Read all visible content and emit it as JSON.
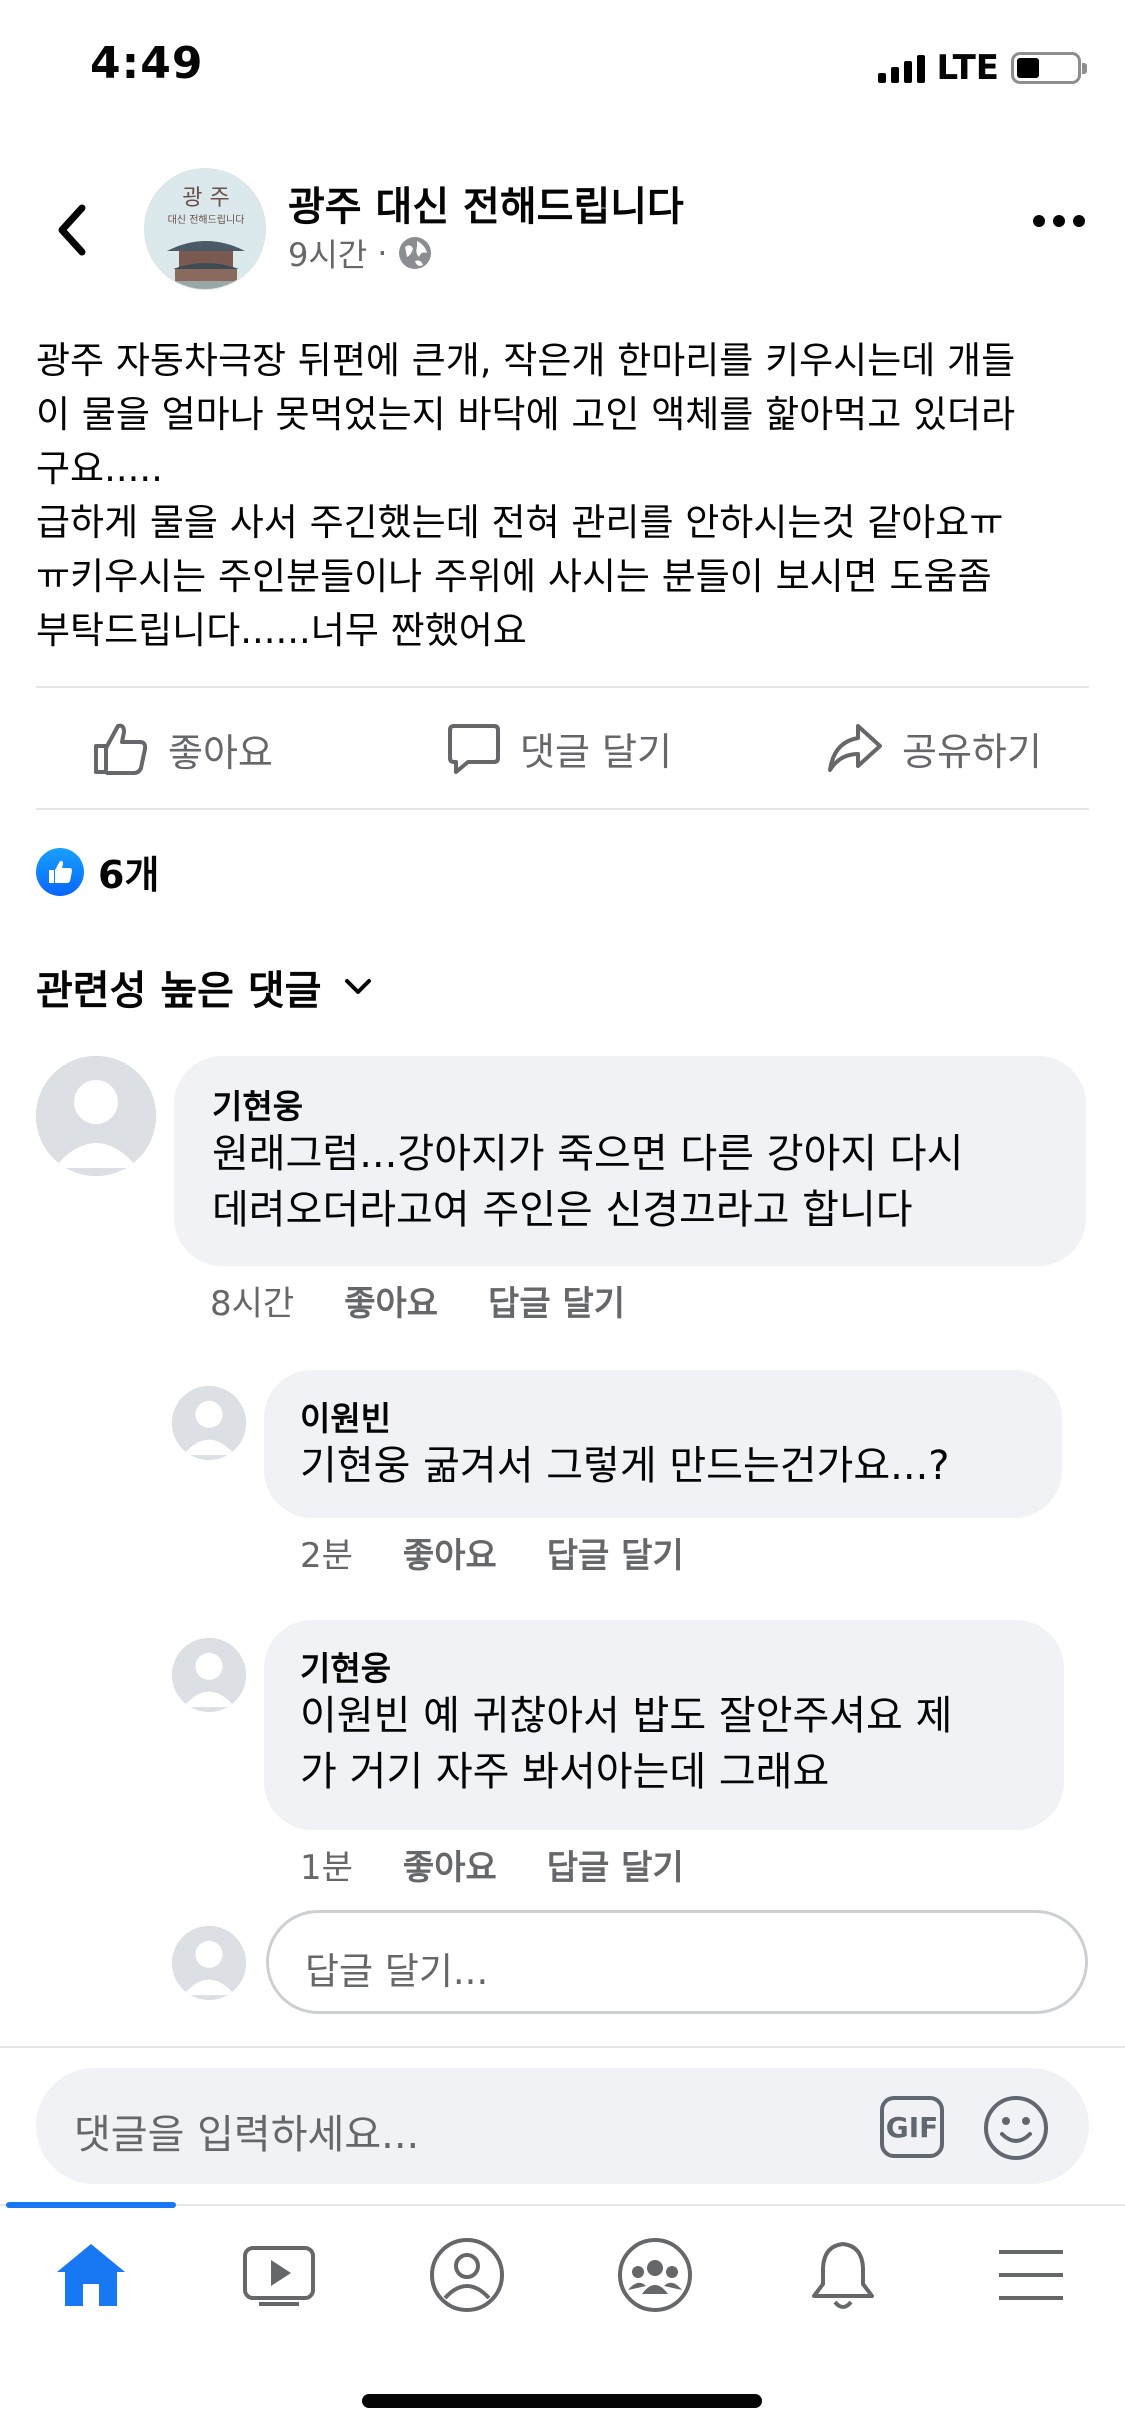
{
  "status_bar": {
    "time": "4:49",
    "network": "LTE"
  },
  "post": {
    "page_name": "광주 대신 전해드립니다",
    "avatar_text_line1": "광 주",
    "avatar_text_line2": "대신 전해드립니다",
    "time": "9시간",
    "separator": "·",
    "text": "광주 자동차극장 뒤편에 큰개, 작은개 한마리를 키우시는데 개들\n이 물을 얼마나 못먹었는지 바닥에 고인 액체를 핥아먹고 있더라\n구요.....\n급하게 물을 사서 주긴했는데 전혀 관리를 안하시는것 같아요ㅠ\nㅠ키우시는 주인분들이나 주위에 사시는 분들이 보시면 도움좀\n부탁드립니다......너무 짠했어요"
  },
  "actions": {
    "like": "좋아요",
    "comment": "댓글 달기",
    "share": "공유하기"
  },
  "reactions": {
    "count": "6개"
  },
  "comments_sort": {
    "label": "관련성 높은 댓글"
  },
  "comments": [
    {
      "name": "기현웅",
      "text": "원래그럼...강아지가 죽으면 다른 강아지 다시\n데려오더라고여 주인은 신경끄라고 합니다",
      "time": "8시간",
      "like": "좋아요",
      "reply": "답글 달기"
    },
    {
      "name": "이원빈",
      "text": "기현웅 굶겨서 그렇게 만드는건가요...?",
      "time": "2분",
      "like": "좋아요",
      "reply": "답글 달기"
    },
    {
      "name": "기현웅",
      "text": "이원빈 예 귀찮아서 밥도 잘안주셔요 제\n가 거기 자주 봐서아는데 그래요",
      "time": "1분",
      "like": "좋아요",
      "reply": "답글 달기"
    }
  ],
  "reply_input": {
    "placeholder": "답글 달기..."
  },
  "composer": {
    "placeholder": "댓글을 입력하세요...",
    "gif_label": "GIF"
  },
  "tabbar": {
    "active": "home",
    "items": [
      "home-icon",
      "watch-icon",
      "profile-icon",
      "groups-icon",
      "notifications-icon",
      "menu-icon"
    ]
  },
  "colors": {
    "accent": "#1877f2",
    "bubble": "#f0f2f5",
    "secondary_text": "#65676b"
  }
}
